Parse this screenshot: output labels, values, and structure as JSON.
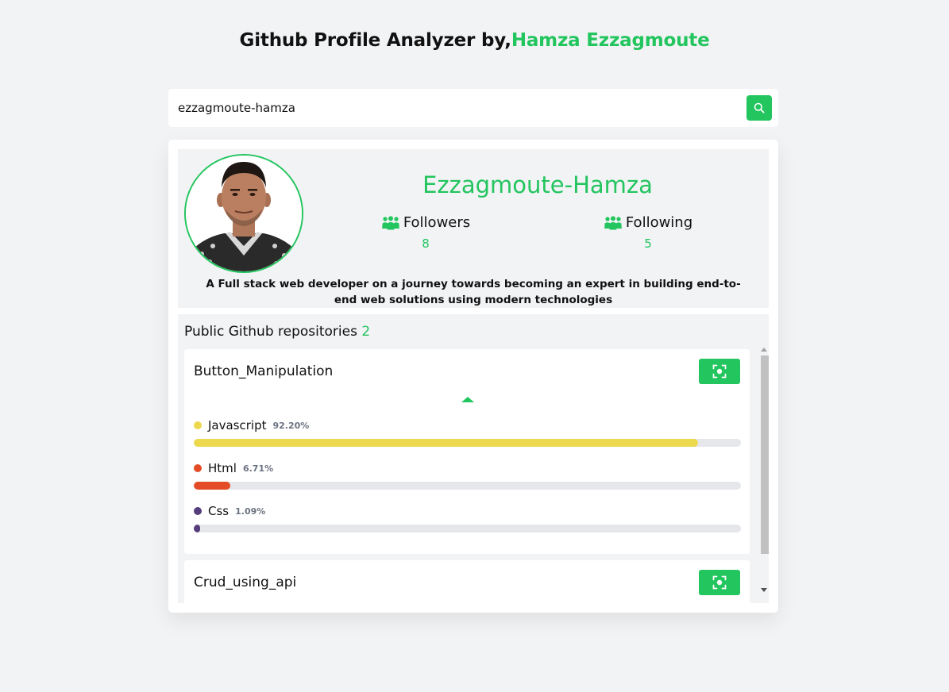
{
  "header": {
    "title_prefix": "Github Profile Analyzer by,",
    "title_author": "Hamza Ezzagmoute"
  },
  "search": {
    "value": "ezzagmoute-hamza",
    "button_icon": "search-icon"
  },
  "profile": {
    "name": "Ezzagmoute-Hamza",
    "followers_label": "Followers",
    "followers_count": "8",
    "following_label": "Following",
    "following_count": "5",
    "stat_icon": "users-icon",
    "bio": "A Full stack web developer on a journey towards becoming an expert in building end-to-end web solutions using modern technologies"
  },
  "repos": {
    "heading": "Public Github repositories",
    "count": "2",
    "items": [
      {
        "name": "Button_Manipulation",
        "action_icon": "focus-icon",
        "expanded": true,
        "languages": [
          {
            "name": "Javascript",
            "percent_label": "92.20%",
            "percent": 92.2,
            "color": "#ecd94e"
          },
          {
            "name": "Html",
            "percent_label": "6.71%",
            "percent": 6.71,
            "color": "#e34c26"
          },
          {
            "name": "Css",
            "percent_label": "1.09%",
            "percent": 1.09,
            "color": "#563d7c"
          }
        ]
      },
      {
        "name": "Crud_using_api",
        "action_icon": "focus-icon",
        "expanded": false
      }
    ]
  },
  "colors": {
    "accent": "#22c55e",
    "background": "#f2f3f5",
    "track": "#e5e7eb"
  }
}
